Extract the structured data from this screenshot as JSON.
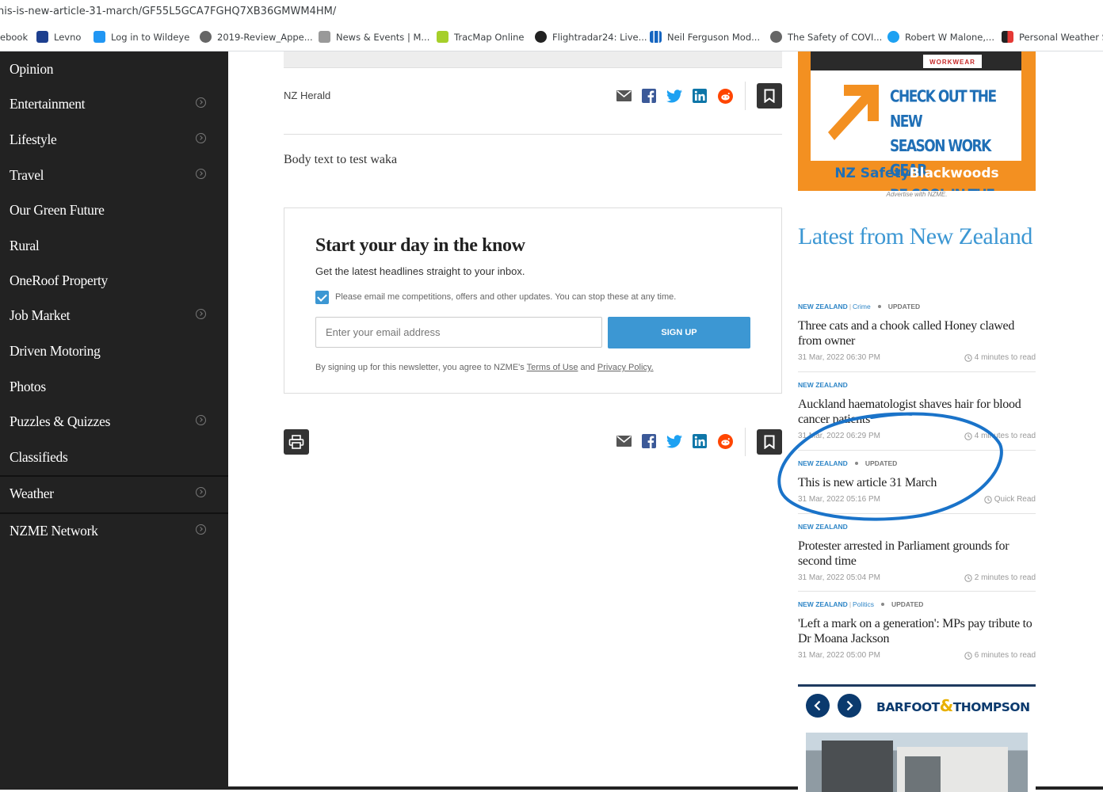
{
  "browser": {
    "url": "his-is-new-article-31-march/GF55L5GCA7FGHQ7XB36GMWM4HM/",
    "bookmarks": [
      {
        "label": "ebook"
      },
      {
        "label": "Levno"
      },
      {
        "label": "Log in to Wildeye"
      },
      {
        "label": "2019-Review_Appe..."
      },
      {
        "label": "News & Events | M..."
      },
      {
        "label": "TracMap Online"
      },
      {
        "label": "Flightradar24: Live..."
      },
      {
        "label": "Neil Ferguson Mod..."
      },
      {
        "label": "The Safety of COVI..."
      },
      {
        "label": "Robert W Malone,..."
      },
      {
        "label": "Personal Weather S..."
      }
    ]
  },
  "sidebar": {
    "items": [
      {
        "label": "Opinion"
      },
      {
        "label": "Entertainment"
      },
      {
        "label": "Lifestyle"
      },
      {
        "label": "Travel"
      },
      {
        "label": "Our Green Future"
      },
      {
        "label": "Rural"
      },
      {
        "label": "OneRoof Property"
      },
      {
        "label": "Job Market"
      },
      {
        "label": "Driven Motoring"
      },
      {
        "label": "Photos"
      },
      {
        "label": "Puzzles & Quizzes"
      },
      {
        "label": "Classifieds"
      },
      {
        "label": "Weather"
      },
      {
        "label": "NZME Network"
      }
    ]
  },
  "article": {
    "source": "NZ Herald",
    "body": "Body text to test waka"
  },
  "newsletter": {
    "title": "Start your day in the know",
    "subtitle": "Get the latest headlines straight to your inbox.",
    "checkbox_label": "Please email me competitions, offers and other updates. You can stop these at any time.",
    "email_placeholder": "Enter your email address",
    "button": "SIGN UP",
    "terms_prefix": "By signing up for this newsletter, you agree to NZME's",
    "terms_link": "Terms of Use",
    "terms_and": "and",
    "privacy_link": "Privacy Policy."
  },
  "ad": {
    "brand": "WORKWEAR",
    "line1": "CHECK OUT THE NEW",
    "line2": "SEASON WORK GEAR",
    "line3": "BE COOL IN THE COLD",
    "footer_a": "NZ Safety",
    "footer_b": "Blackwoods",
    "note": "Advertise with NZME."
  },
  "latest": {
    "title": "Latest from New Zealand",
    "articles": [
      {
        "section": "NEW ZEALAND",
        "sub": "Crime",
        "updated": "UPDATED",
        "headline": "Three cats and a chook called Honey clawed from owner",
        "date": "31 Mar, 2022 06:30 PM",
        "read": "4 minutes to read"
      },
      {
        "section": "NEW ZEALAND",
        "sub": "",
        "updated": "",
        "headline": "Auckland haematologist shaves hair for blood cancer patients",
        "date": "31 Mar, 2022 06:29 PM",
        "read": "4 minutes to read"
      },
      {
        "section": "NEW ZEALAND",
        "sub": "",
        "updated": "UPDATED",
        "headline": "This is new article 31 March",
        "date": "31 Mar, 2022 05:16 PM",
        "read": "Quick Read"
      },
      {
        "section": "NEW ZEALAND",
        "sub": "",
        "updated": "",
        "headline": "Protester arrested in Parliament grounds for second time",
        "date": "31 Mar, 2022 05:04 PM",
        "read": "2 minutes to read"
      },
      {
        "section": "NEW ZEALAND",
        "sub": "Politics",
        "updated": "UPDATED",
        "headline": "'Left a mark on a generation': MPs pay tribute to Dr Moana Jackson",
        "date": "31 Mar, 2022 05:00 PM",
        "read": "6 minutes to read"
      }
    ]
  },
  "promo": {
    "logo_a": "BARFOOT",
    "logo_amp": "&",
    "logo_b": "THOMPSON"
  },
  "colors": {
    "accent": "#3c97d3",
    "sidebar": "#222222",
    "annotation": "#1a73c9"
  }
}
